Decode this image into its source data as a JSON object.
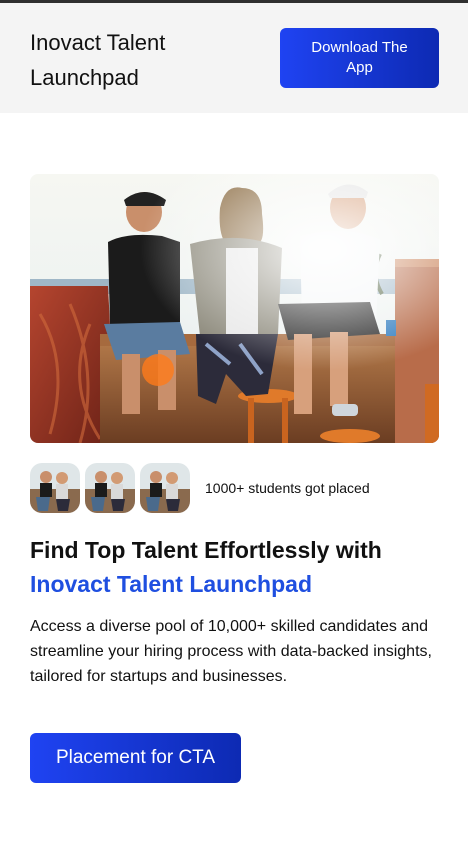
{
  "header": {
    "brand": "Inovact Talent Launchpad",
    "download_label": "Download The App"
  },
  "hero": {
    "image": "photo-three-friends-sitting-on-wall-at-sunset"
  },
  "social_proof": {
    "avatar_count": 3,
    "text": "1000+ students got placed"
  },
  "headline": {
    "line1": "Find Top Talent Effortlessly with",
    "accent": "Inovact Talent Launchpad"
  },
  "description": "Access a diverse pool of 10,000+ skilled candidates and streamline your hiring process with data-backed insights, tailored for startups and businesses.",
  "cta": {
    "label": "Placement for CTA"
  },
  "colors": {
    "accent": "#1f4fe0",
    "button_start": "#1f43f2",
    "button_end": "#0d2ab3",
    "header_bg": "#f4f4f4"
  }
}
